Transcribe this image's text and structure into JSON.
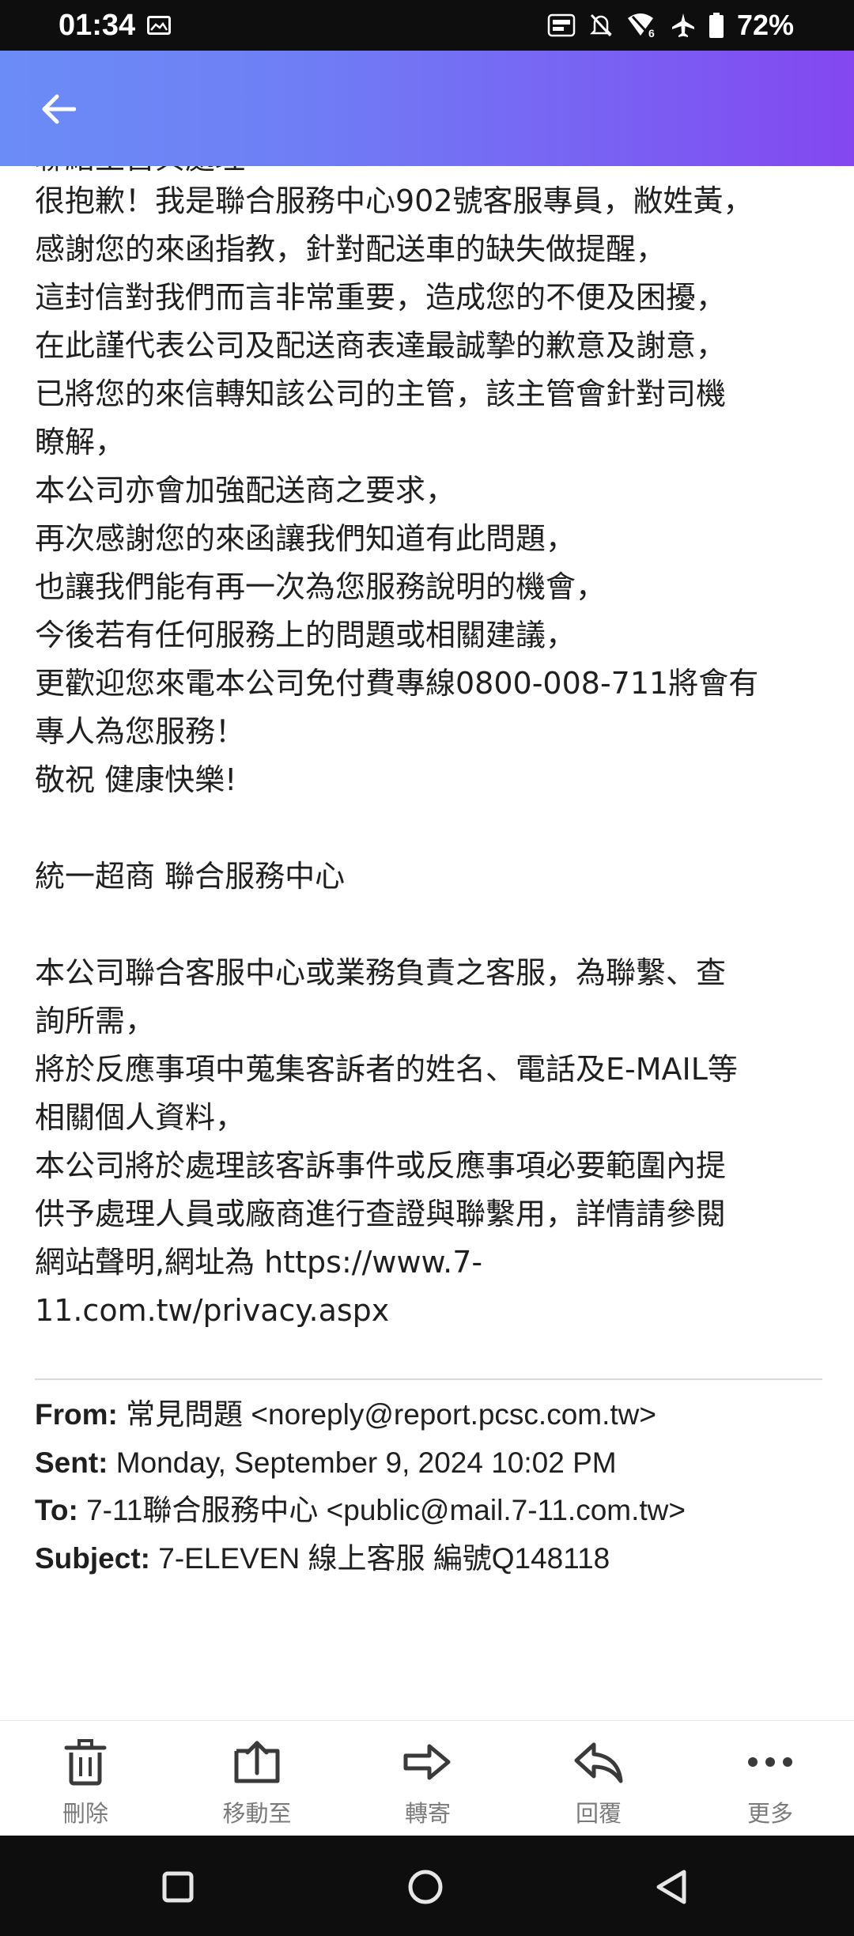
{
  "status_bar": {
    "time": "01:34",
    "battery": "72%",
    "icons": [
      "image-icon",
      "auto-hz-icon",
      "silent-icon",
      "wifi-6-icon",
      "airplane-icon",
      "battery-icon"
    ]
  },
  "header": {
    "back_icon": "arrow-left-icon",
    "colors": {
      "start": "#6b8cf6",
      "end": "#8447ef"
    }
  },
  "email": {
    "cut_line": "聯絡主旨與處理",
    "body_lines": [
      "很抱歉！我是聯合服務中心902號客服專員，敝姓黃，",
      "感謝您的來函指教，針對配送車的缺失做提醒，",
      "這封信對我們而言非常重要，造成您的不便及困擾，",
      "在此謹代表公司及配送商表達最誠摯的歉意及謝意，",
      "已將您的來信轉知該公司的主管，該主管會針對司機",
      "瞭解，",
      "本公司亦會加強配送商之要求，",
      "再次感謝您的來函讓我們知道有此問題，",
      "也讓我們能有再一次為您服務說明的機會，",
      "今後若有任何服務上的問題或相關建議，",
      "更歡迎您來電本公司免付費專線0800-008-711將會有",
      "專人為您服務！",
      "敬祝 健康快樂!",
      "",
      "統一超商 聯合服務中心",
      "",
      "本公司聯合客服中心或業務負責之客服，為聯繫、查",
      "詢所需，",
      "將於反應事項中蒐集客訴者的姓名、電話及E-MAIL等",
      "相關個人資料，",
      "本公司將於處理該客訴事件或反應事項必要範圍內提",
      "供予處理人員或廠商進行查證與聯繫用，詳情請參閱",
      "網站聲明,網址為 https://www.7-",
      "11.com.tw/privacy.aspx"
    ],
    "meta": {
      "from_label": "From:",
      "from_value": "常見問題 <noreply@report.pcsc.com.tw>",
      "sent_label": "Sent:",
      "sent_value": "Monday, September 9, 2024 10:02 PM",
      "to_label": "To:",
      "to_value": "7-11聯合服務中心 <public@mail.7-11.com.tw>",
      "subject_label": "Subject:",
      "subject_value": "7-ELEVEN 線上客服 編號Q148118"
    }
  },
  "toolbar": {
    "delete_label": "刪除",
    "move_label": "移動至",
    "forward_label": "轉寄",
    "reply_label": "回覆",
    "more_label": "更多"
  },
  "nav": {
    "icons": [
      "recents-icon",
      "home-icon",
      "back-nav-icon"
    ]
  }
}
